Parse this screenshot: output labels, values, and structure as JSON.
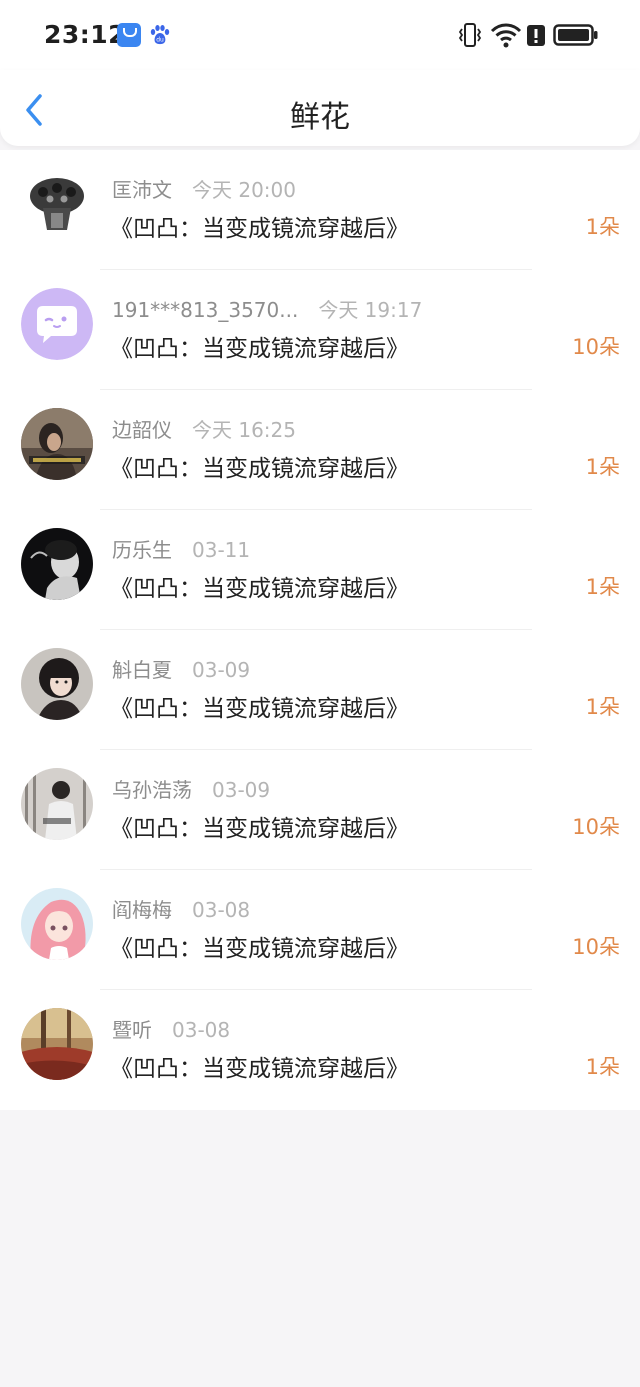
{
  "status_bar": {
    "time": "23:12"
  },
  "header": {
    "title": "鲜花"
  },
  "colors": {
    "accent_blue": "#3b8ff0",
    "count_orange": "#e1894a",
    "name_gray": "#8d8d8d",
    "date_gray": "#b4b4b4"
  },
  "items": [
    {
      "name": "匡沛文",
      "date": "今天 20:00",
      "book": "《凹凸：当变成镜流穿越后》",
      "count": "1朵",
      "avatar": "skull-ring-avatar"
    },
    {
      "name": "191***813_3570...",
      "date": "今天 19:17",
      "book": "《凹凸：当变成镜流穿越后》",
      "count": "10朵",
      "avatar": "default-chat-avatar"
    },
    {
      "name": "边韶仪",
      "date": "今天 16:25",
      "book": "《凹凸：当变成镜流穿越后》",
      "count": "1朵",
      "avatar": "photo-avatar"
    },
    {
      "name": "历乐生",
      "date": "03-11",
      "book": "《凹凸：当变成镜流穿越后》",
      "count": "1朵",
      "avatar": "photo-avatar"
    },
    {
      "name": "斛白夏",
      "date": "03-09",
      "book": "《凹凸：当变成镜流穿越后》",
      "count": "1朵",
      "avatar": "photo-avatar"
    },
    {
      "name": "乌孙浩荡",
      "date": "03-09",
      "book": "《凹凸：当变成镜流穿越后》",
      "count": "10朵",
      "avatar": "photo-avatar"
    },
    {
      "name": "阎梅梅",
      "date": "03-08",
      "book": "《凹凸：当变成镜流穿越后》",
      "count": "10朵",
      "avatar": "anime-avatar"
    },
    {
      "name": "暨听",
      "date": "03-08",
      "book": "《凹凸：当变成镜流穿越后》",
      "count": "1朵",
      "avatar": "photo-avatar"
    }
  ]
}
